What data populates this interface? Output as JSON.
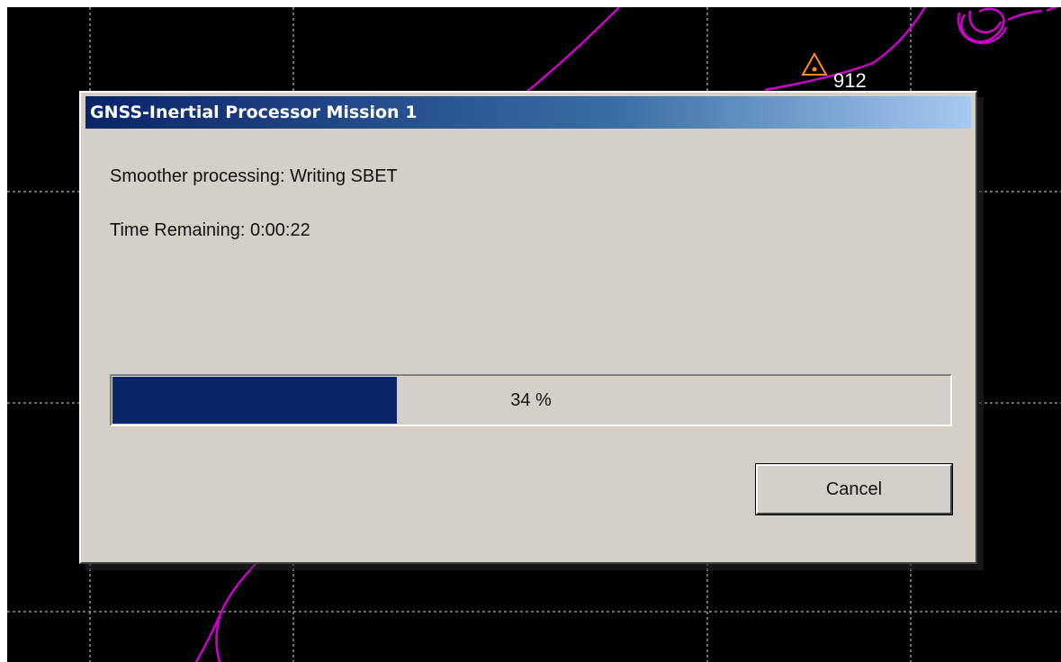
{
  "map": {
    "station_label": "912",
    "track_color": "#cc00cc",
    "marker_color": "#ff8c1a",
    "grid_color": "#d8d8d8"
  },
  "dialog": {
    "title": "GNSS-Inertial Processor Mission 1",
    "status_text": "Smoother processing: Writing SBET",
    "time_remaining": "Time Remaining: 0:00:22",
    "progress_percent": 34,
    "progress_label": "34 %",
    "cancel_label": "Cancel",
    "titlebar_colors": [
      "#0a246a",
      "#a6caf0"
    ],
    "progress_fill_color": "#0a246a"
  }
}
